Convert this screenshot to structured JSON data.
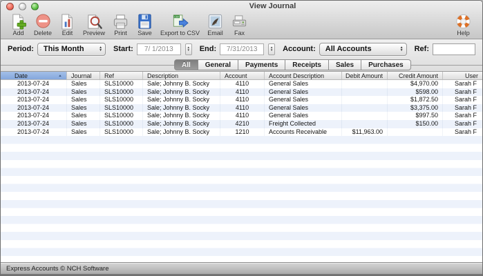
{
  "window": {
    "title": "View Journal"
  },
  "toolbar": {
    "buttons": [
      {
        "label": "Add",
        "icon": "doc-plus-icon"
      },
      {
        "label": "Delete",
        "icon": "minus-circle-icon"
      },
      {
        "label": "Edit",
        "icon": "doc-chart-icon"
      },
      {
        "label": "Preview",
        "icon": "doc-magnifier-icon"
      },
      {
        "label": "Print",
        "icon": "printer-icon"
      },
      {
        "label": "Save",
        "icon": "floppy-disk-icon"
      },
      {
        "label": "Export to CSV",
        "icon": "csv-export-icon"
      },
      {
        "label": "Email",
        "icon": "mail-stamp-icon"
      },
      {
        "label": "Fax",
        "icon": "fax-machine-icon"
      }
    ],
    "help_label": "Help"
  },
  "filters": {
    "period_label": "Period:",
    "period_value": "This Month",
    "start_label": "Start:",
    "start_value": "7/ 1/2013",
    "end_label": "End:",
    "end_value": "7/31/2013",
    "account_label": "Account:",
    "account_value": "All Accounts",
    "ref_label": "Ref:",
    "ref_value": ""
  },
  "tabs": [
    {
      "label": "All",
      "selected": true
    },
    {
      "label": "General",
      "selected": false
    },
    {
      "label": "Payments",
      "selected": false
    },
    {
      "label": "Receipts",
      "selected": false
    },
    {
      "label": "Sales",
      "selected": false
    },
    {
      "label": "Purchases",
      "selected": false
    }
  ],
  "table": {
    "columns": [
      "Date",
      "Journal",
      "Ref",
      "Description",
      "Account",
      "Account Description",
      "Debit Amount",
      "Credit Amount",
      "User"
    ],
    "sort": {
      "column": "Date",
      "direction": "ascending"
    },
    "rows": [
      [
        "2013-07-24",
        "Sales",
        "SLS10000",
        "Sale; Johnny B. Socky",
        "4110",
        "General Sales",
        "",
        "$4,970.00",
        "Sarah F"
      ],
      [
        "2013-07-24",
        "Sales",
        "SLS10000",
        "Sale; Johnny B. Socky",
        "4110",
        "General Sales",
        "",
        "$598.00",
        "Sarah F"
      ],
      [
        "2013-07-24",
        "Sales",
        "SLS10000",
        "Sale; Johnny B. Socky",
        "4110",
        "General Sales",
        "",
        "$1,872.50",
        "Sarah F"
      ],
      [
        "2013-07-24",
        "Sales",
        "SLS10000",
        "Sale; Johnny B. Socky",
        "4110",
        "General Sales",
        "",
        "$3,375.00",
        "Sarah F"
      ],
      [
        "2013-07-24",
        "Sales",
        "SLS10000",
        "Sale; Johnny B. Socky",
        "4110",
        "General Sales",
        "",
        "$997.50",
        "Sarah F"
      ],
      [
        "2013-07-24",
        "Sales",
        "SLS10000",
        "Sale; Johnny B. Socky",
        "4210",
        "Freight Collected",
        "",
        "$150.00",
        "Sarah F"
      ],
      [
        "2013-07-24",
        "Sales",
        "SLS10000",
        "Sale; Johnny B. Socky",
        "1210",
        "Accounts Receivable",
        "$11,963.00",
        "",
        "Sarah F"
      ]
    ]
  },
  "statusbar": {
    "text": "Express Accounts © NCH Software"
  },
  "colors": {
    "sorted_header_bg": "#8fb2e2",
    "row_stripe": "#edf2fb",
    "selected_tab_bg": "#8a8a8a",
    "help_ring": "#dd7026"
  }
}
